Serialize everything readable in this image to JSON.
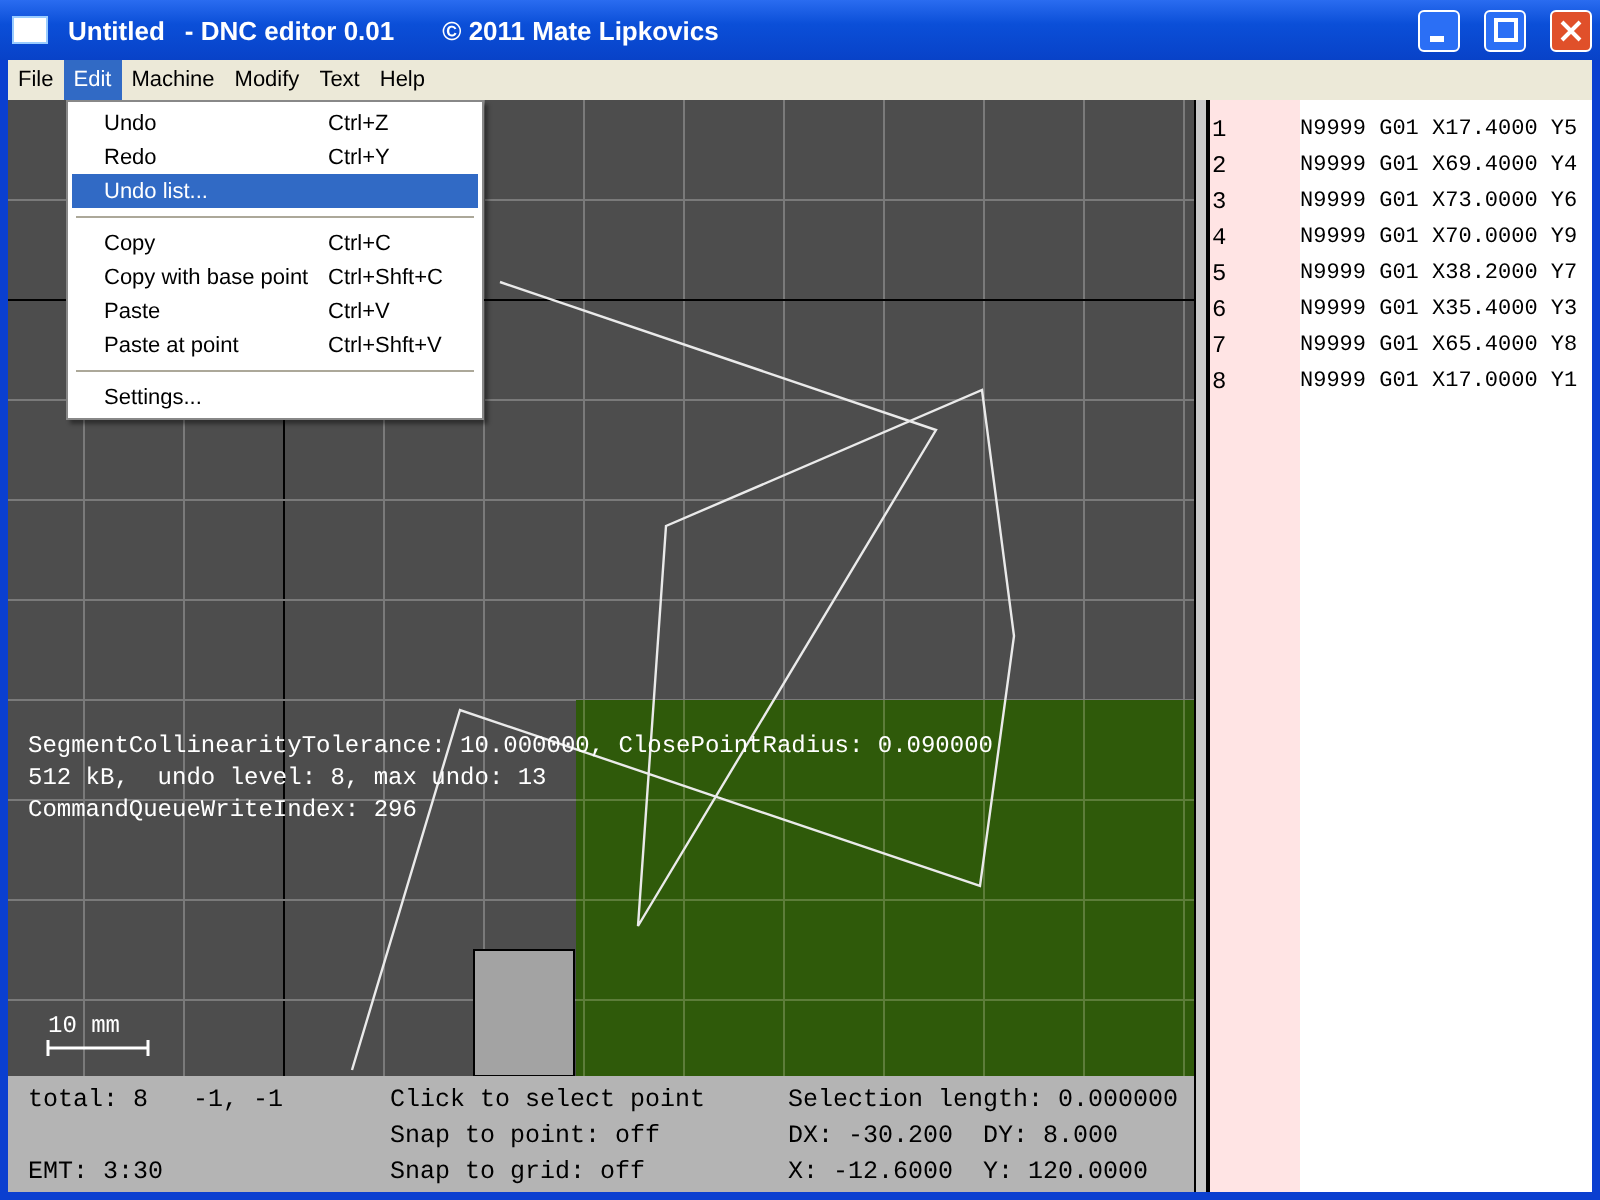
{
  "window": {
    "title_parts": [
      "Untitled",
      "- DNC editor 0.01",
      "© 2011 Mate Lipkovics"
    ]
  },
  "menu_bar": [
    {
      "label": "File",
      "selected": false
    },
    {
      "label": "Edit",
      "selected": true
    },
    {
      "label": "Machine",
      "selected": false
    },
    {
      "label": "Modify",
      "selected": false
    },
    {
      "label": "Text",
      "selected": false
    },
    {
      "label": "Help",
      "selected": false
    }
  ],
  "dropdown": [
    {
      "kind": "item",
      "label": "Undo",
      "shortcut": "Ctrl+Z",
      "selected": false
    },
    {
      "kind": "item",
      "label": "Redo",
      "shortcut": "Ctrl+Y",
      "selected": false
    },
    {
      "kind": "item",
      "label": "Undo list...",
      "selected": true
    },
    {
      "kind": "separator"
    },
    {
      "kind": "item",
      "label": "Copy",
      "shortcut": "Ctrl+C",
      "selected": false
    },
    {
      "kind": "item",
      "label": "Copy with base point",
      "shortcut": "Ctrl+Shft+C",
      "selected": false
    },
    {
      "kind": "item",
      "label": "Paste",
      "shortcut": "Ctrl+V",
      "selected": false
    },
    {
      "kind": "item",
      "label": "Paste at point",
      "shortcut": "Ctrl+Shft+V",
      "selected": false
    },
    {
      "kind": "separator"
    },
    {
      "kind": "item",
      "label": "Settings...",
      "selected": false
    }
  ],
  "canvas": {
    "info_lines": [
      "SegmentCollinearityTolerance: 10.000000, ClosePointRadius: 0.090000",
      "512 kB,  undo level: 8, max undo: 13",
      "CommandQueueWriteIndex: 296"
    ],
    "scale_label": "10 mm"
  },
  "status_bar": {
    "column_1": [
      "total: 8   -1, -1",
      "EMT: 3:30"
    ],
    "column_2": [
      "Click to select point",
      "Snap to point: off",
      "Snap to grid: off"
    ],
    "column_3": [
      "Selection length: 0.000000",
      "DX: -30.200  DY: 8.000",
      "X: -12.6000  Y: 120.0000"
    ]
  },
  "code_lines": [
    {
      "number": "1",
      "code": "N9999 G01 X17.4000 Y5"
    },
    {
      "number": "2",
      "code": "N9999 G01 X69.4000 Y4"
    },
    {
      "number": "3",
      "code": "N9999 G01 X73.0000 Y6"
    },
    {
      "number": "4",
      "code": "N9999 G01 X70.0000 Y9"
    },
    {
      "number": "5",
      "code": "N9999 G01 X38.2000 Y7"
    },
    {
      "number": "6",
      "code": "N9999 G01 X35.4000 Y3"
    },
    {
      "number": "7",
      "code": "N9999 G01 X65.4000 Y8"
    },
    {
      "number": "8",
      "code": "N9999 G01 X17.0000 Y1"
    }
  ]
}
